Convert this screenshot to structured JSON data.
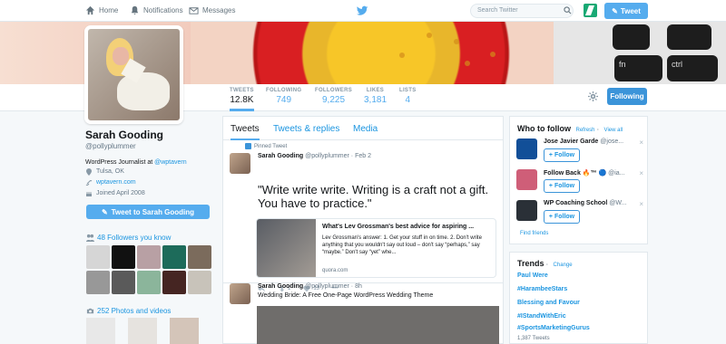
{
  "nav": {
    "home": "Home",
    "notifications": "Notifications",
    "messages": "Messages",
    "search_placeholder": "Search Twitter",
    "tweet_button": "Tweet"
  },
  "banner": {
    "key1": "fn",
    "key2": "ctrl"
  },
  "profile": {
    "name": "Sarah Gooding",
    "handle": "@pollyplummer",
    "bio_prefix": "WordPress Journalist at ",
    "bio_link": "@wptavern",
    "location": "Tulsa, OK",
    "website": "wptavern.com",
    "joined": "Joined April 2008",
    "tweet_to": "Tweet to Sarah Gooding",
    "followers_you_know": "48 Followers you know",
    "photos_videos": "252 Photos and videos"
  },
  "stats": [
    {
      "label": "TWEETS",
      "value": "12.8K"
    },
    {
      "label": "FOLLOWING",
      "value": "749"
    },
    {
      "label": "FOLLOWERS",
      "value": "9,225"
    },
    {
      "label": "LIKES",
      "value": "3,181"
    },
    {
      "label": "LISTS",
      "value": "4"
    }
  ],
  "actions": {
    "following": "Following"
  },
  "tabs": {
    "tweets": "Tweets",
    "replies": "Tweets & replies",
    "media": "Media"
  },
  "tweets": [
    {
      "pinned": "Pinned Tweet",
      "name": "Sarah Gooding",
      "meta": "@pollyplummer · Feb 2",
      "text": "\"Write write write. Writing is a craft not a gift. You have to practice.\"",
      "card_title": "What's Lev Grossman's best advice for aspiring ...",
      "card_body": "Lev Grossman's answer: 1. Get your stuff in on time. 2. Don't write anything that you wouldn't say out loud – don't say “perhaps,” say “maybe.” Don't say “yet” whe...",
      "card_url": "quora.com",
      "retweets": "1",
      "likes": "13"
    },
    {
      "name": "Sarah Gooding",
      "meta": "@pollyplummer · 8h",
      "text": "Wedding Bride: A Free One-Page WordPress Wedding Theme"
    }
  ],
  "who_to_follow": {
    "title": "Who to follow",
    "refresh": "Refresh",
    "view_all": "View all",
    "follow_label": "Follow",
    "find_friends": "Find friends",
    "suggestions": [
      {
        "name": "Jose Javier Garde",
        "handle": "@jose...",
        "color": "#124f98"
      },
      {
        "name": "Follow Back 🔥™ 🔵",
        "handle": "@ia...",
        "color": "#cf5e78"
      },
      {
        "name": "WP Coaching School",
        "handle": "@W...",
        "color": "#2a3037"
      }
    ]
  },
  "trends": {
    "title": "Trends",
    "change": "Change",
    "items": [
      "Paul Were",
      "#HarambeeStars",
      "Blessing and Favour",
      "#IStandWithEric",
      "#SportsMarketingGurus"
    ],
    "last_count": "1,387 Tweets"
  }
}
